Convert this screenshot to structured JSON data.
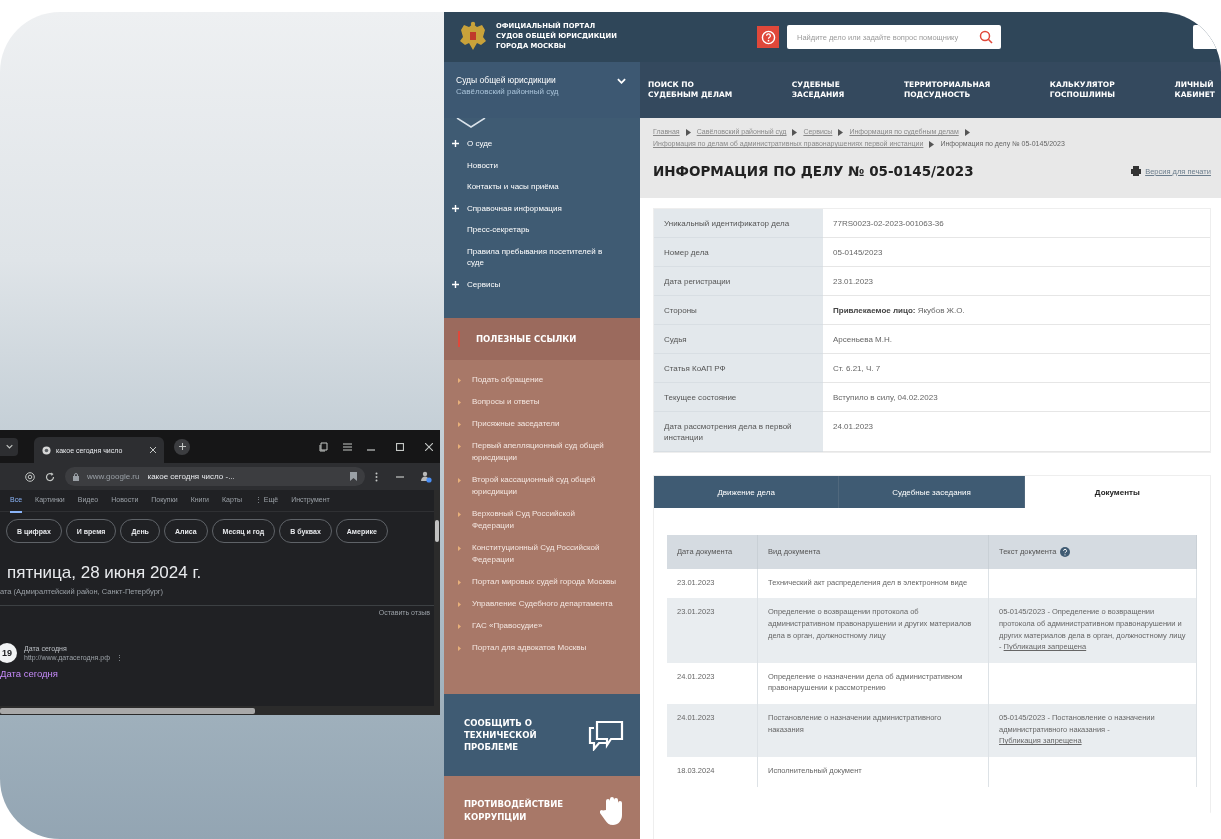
{
  "court_site": {
    "header": {
      "portal_title": "ОФИЦИАЛЬНЫЙ ПОРТАЛ\nСУДОВ ОБЩЕЙ ЮРИСДИКЦИИ\nГОРОДА МОСКВЫ",
      "search": {
        "placeholder": "Найдите дело или задайте вопрос помощнику"
      }
    },
    "court_selector": {
      "title": "Суды общей юрисдикции",
      "subtitle": "Савёловский районный суд"
    },
    "nav": [
      "ПОИСК ПО\nСУДЕБНЫМ ДЕЛАМ",
      "СУДЕБНЫЕ\nЗАСЕДАНИЯ",
      "ТЕРРИТОРИАЛЬНАЯ\nПОДСУДНОСТЬ",
      "КАЛЬКУЛЯТОР\nГОСПОШЛИНЫ",
      "ЛИЧНЫЙ\nКАБИНЕТ"
    ],
    "sidebar_menu": [
      {
        "label": "О суде",
        "kind": "section"
      },
      {
        "label": "Новости",
        "kind": "link"
      },
      {
        "label": "Контакты и часы приёма",
        "kind": "link"
      },
      {
        "label": "Справочная информация",
        "kind": "section"
      },
      {
        "label": "Пресс-секретарь",
        "kind": "link"
      },
      {
        "label": "Правила пребывания посетителей в суде",
        "kind": "link"
      },
      {
        "label": "Сервисы",
        "kind": "section"
      }
    ],
    "useful_links": {
      "title": "ПОЛЕЗНЫЕ ССЫЛКИ",
      "items": [
        "Подать обращение",
        "Вопросы и ответы",
        "Присяжные заседатели",
        "Первый апелляционный суд общей юрисдикции",
        "Второй кассационный суд общей юрисдикции",
        "Верховный Суд Российской Федерации",
        "Конституционный Суд Российской Федерации",
        "Портал мировых судей города Москвы",
        "Управление Судебного департамента",
        "ГАС «Правосудие»",
        "Портал для адвокатов Москвы"
      ]
    },
    "report_banner": "СООБЩИТЬ О\nТЕХНИЧЕСКОЙ\nПРОБЛЕМЕ",
    "anticorruption_banner": "ПРОТИВОДЕЙСТВИЕ\nКОРРУПЦИИ",
    "breadcrumbs": [
      {
        "label": "Главная",
        "current": false
      },
      {
        "label": "Савёловский районный суд",
        "current": false
      },
      {
        "label": "Сервисы",
        "current": false
      },
      {
        "label": "Информация по судебным делам",
        "current": false
      },
      {
        "label": "Информация по делам об административных правонарушениях первой инстанции",
        "current": false
      },
      {
        "label": "Информация по делу № 05-0145/2023",
        "current": true
      }
    ],
    "page_title": "ИНФОРМАЦИЯ ПО ДЕЛУ № 05-0145/2023",
    "print_link": "Версия для печати",
    "case_info": [
      {
        "label": "Уникальный идентификатор дела",
        "value": "77RS0023-02-2023-001063-36"
      },
      {
        "label": "Номер дела",
        "value": "05-0145/2023"
      },
      {
        "label": "Дата регистрации",
        "value": "23.01.2023"
      },
      {
        "label": "Стороны",
        "value": "**Привлекаемое лицо:** Якубов Ж.О."
      },
      {
        "label": "Судья",
        "value": "Арсеньева М.Н."
      },
      {
        "label": "Статья КоАП РФ",
        "value": "Ст. 6.21, Ч. 7"
      },
      {
        "label": "Текущее состояние",
        "value": "Вступило в силу, 04.02.2023"
      },
      {
        "label": "Дата рассмотрения дела в первой инстанции",
        "value": "24.01.2023"
      }
    ],
    "tabs": [
      {
        "label": "Движение дела",
        "selected": false
      },
      {
        "label": "Судебные заседания",
        "selected": false
      },
      {
        "label": "Документы",
        "selected": true
      }
    ],
    "documents": {
      "columns": [
        "Дата документа",
        "Вид документа",
        "Текст документа"
      ],
      "rows": [
        {
          "date": "23.01.2023",
          "type": "Технический акт распределения дел в электронном виде"
        },
        {
          "date": "23.01.2023",
          "type": "Определение о возвращении протокола об административном правонарушении и других материалов дела в орган, должностному лицу",
          "text": "05-0145/2023 - Определение о возвращении протокола об административном правонарушении и других материалов дела в орган, должностному лицу -",
          "link": "Публикация запрещена"
        },
        {
          "date": "24.01.2023",
          "type": "Определение о назначении дела об административном правонарушении к рассмотрению"
        },
        {
          "date": "24.01.2023",
          "type": "Постановление о назначении административного наказания",
          "text": "05-0145/2023 - Постановление о назначении административного наказания -",
          "link": "Публикация запрещена"
        },
        {
          "date": "18.03.2024",
          "type": "Исполнительный документ"
        }
      ]
    }
  },
  "browser": {
    "tab_title": "какое сегодня число",
    "address_domain": "www.google.ru",
    "address_query": "какое сегодня число -...",
    "search_tabs": [
      {
        "label": "Все",
        "selected": true
      },
      {
        "label": "Картинки",
        "selected": false
      },
      {
        "label": "Видео",
        "selected": false
      },
      {
        "label": "Новости",
        "selected": false
      },
      {
        "label": "Покупки",
        "selected": false
      },
      {
        "label": "Книги",
        "selected": false
      },
      {
        "label": "Карты",
        "selected": false
      },
      {
        "label": "⋮ Ещё",
        "selected": false
      },
      {
        "label": "Инструмент",
        "selected": false
      }
    ],
    "chips": [
      "В цифрах",
      "И время",
      "День",
      "Алиса",
      "Месяц и год",
      "В буквах",
      "Америке"
    ],
    "answer": "пятница, 28 июня 2024 г.",
    "answer_caption": "ата (Адмиралтейский район, Санкт-Петербург)",
    "feedback_link": "Оставить отзыв",
    "result": {
      "favicon_text": "19",
      "site_name": "Дата сегодня",
      "url": "http://www.датасегодня.рф",
      "menu": "⋮",
      "title": "Дата сегодня"
    }
  }
}
